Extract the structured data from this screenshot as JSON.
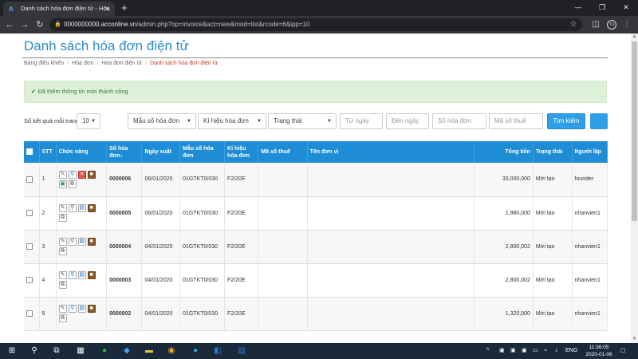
{
  "browser": {
    "tab_title": "Danh sách hóa đơn điện tử - Hóa",
    "tab_favicon": "A",
    "url_host": "0000000000.acconline.vn",
    "url_path": "/admin.php?op=invoice&act=new&mod=list&rcode=6&ipp=10",
    "profile_label": "TU"
  },
  "page": {
    "title": "Danh sách hóa đơn điện tử",
    "breadcrumb": [
      "Bảng điều khiển",
      "Hóa đơn",
      "Hóa đơn điện tử",
      "Danh sách hóa đơn điện tử"
    ],
    "alert": "Đã thêm thông tin mới thành công"
  },
  "filters": {
    "per_page_label": "Số kết quả mỗi trang",
    "per_page_value": "10",
    "template_placeholder": "Mẫu số hóa đơn",
    "symbol_placeholder": "Kí hiệu hóa đơn",
    "status_placeholder": "Trạng thái",
    "from_date_placeholder": "Từ ngày",
    "to_date_placeholder": "Đến ngày",
    "invoice_no_placeholder": "Số hóa đơn",
    "tax_code_placeholder": "Mã số thuế",
    "search_label": "Tìm kiếm"
  },
  "table": {
    "headers": {
      "stt": "STT",
      "actions": "Chức năng",
      "invoice_no": "Số hóa đơn↓",
      "issue_date": "Ngày xuất",
      "template": "Mẫu số hóa đơn",
      "symbol": "Kí hiệu hóa đơn",
      "tax_code": "Mã số thuế",
      "unit_name": "Tên đơn vị",
      "total": "Tổng tiền",
      "status": "Trạng thái",
      "creator": "Người lập"
    },
    "rows": [
      {
        "stt": "1",
        "invoice_no": "0000006",
        "issue_date": "06/01/2020",
        "template": "01GTKT0/030",
        "symbol": "F2/20E",
        "tax_code": "",
        "unit_name": "",
        "total": "33,000,000",
        "status": "Mới tạo",
        "creator": "founder"
      },
      {
        "stt": "2",
        "invoice_no": "0000005",
        "issue_date": "06/01/2020",
        "template": "01GTKT0/030",
        "symbol": "F2/20E",
        "tax_code": "",
        "unit_name": "",
        "total": "1,980,000",
        "status": "Mới tạo",
        "creator": "nhanvien1"
      },
      {
        "stt": "3",
        "invoice_no": "0000004",
        "issue_date": "04/01/2020",
        "template": "01GTKT0/030",
        "symbol": "F2/20E",
        "tax_code": "",
        "unit_name": "",
        "total": "2,800,002",
        "status": "Mới tạo",
        "creator": "nhanvien1"
      },
      {
        "stt": "4",
        "invoice_no": "0000003",
        "issue_date": "04/01/2020",
        "template": "01GTKT0/030",
        "symbol": "F2/20E",
        "tax_code": "",
        "unit_name": "",
        "total": "2,800,002",
        "status": "Mới tạo",
        "creator": "nhanvien1"
      },
      {
        "stt": "5",
        "invoice_no": "0000002",
        "issue_date": "04/01/2020",
        "template": "01GTKT0/030",
        "symbol": "F2/20E",
        "tax_code": "",
        "unit_name": "",
        "total": "1,320,000",
        "status": "Mới tạo",
        "creator": "nhanvien1"
      }
    ]
  },
  "taskbar": {
    "language": "ENG",
    "time": "11:36:05",
    "date": "2020-01-06"
  },
  "colors": {
    "accent": "#2e8bcf",
    "table_header": "#1f8dd6",
    "alert_bg": "#dff0d8"
  }
}
